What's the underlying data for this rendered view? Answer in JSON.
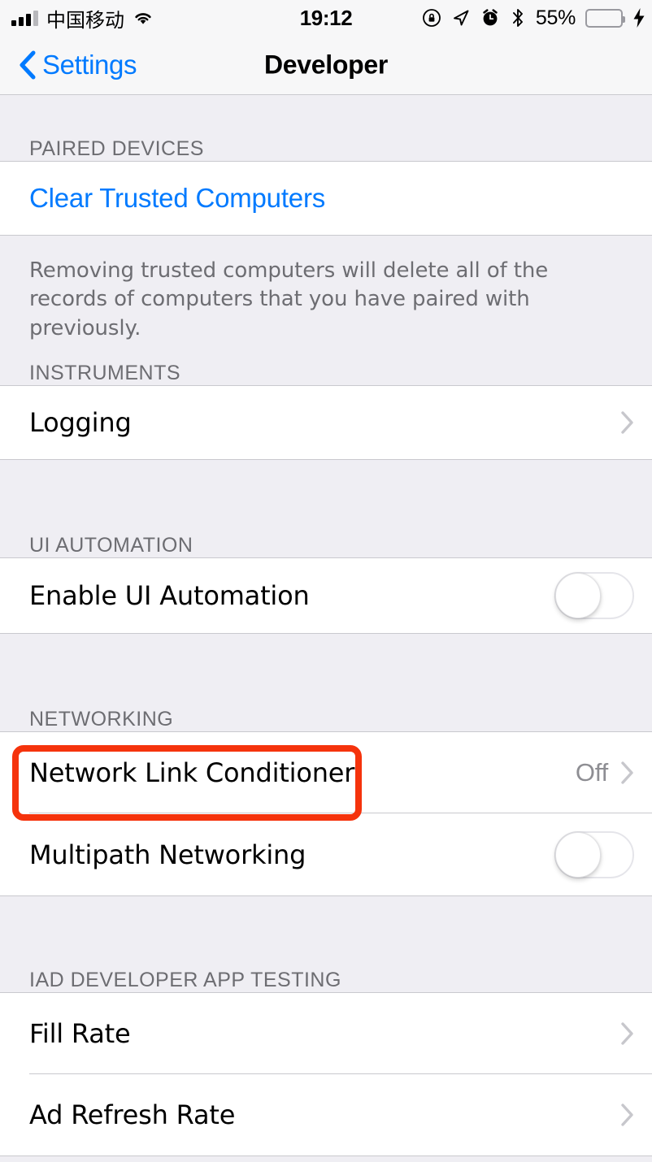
{
  "status_bar": {
    "carrier": "中国移动",
    "time": "19:12",
    "battery_percent": "55%",
    "signal_bars_filled": 3,
    "signal_bars_total": 4,
    "battery_fill_ratio": 0.55,
    "battery_color": "#4CD964",
    "icons": [
      "signal-bars-icon",
      "wifi-icon",
      "rotation-lock-icon",
      "location-arrow-icon",
      "alarm-clock-icon",
      "bluetooth-icon",
      "battery-icon",
      "charging-bolt-icon"
    ]
  },
  "nav_bar": {
    "back_label": "Settings",
    "title": "Developer",
    "accent_color": "#007AFF"
  },
  "sections": [
    {
      "header": "PAIRED DEVICES",
      "rows": [
        {
          "label": "Clear Trusted Computers",
          "type": "link"
        }
      ],
      "footer": "Removing trusted computers will delete all of the records of computers that you have paired with previously."
    },
    {
      "header": "INSTRUMENTS",
      "rows": [
        {
          "label": "Logging",
          "type": "disclosure"
        }
      ]
    },
    {
      "header": "UI AUTOMATION",
      "rows": [
        {
          "label": "Enable UI Automation",
          "type": "toggle",
          "value": "off"
        }
      ]
    },
    {
      "header": "NETWORKING",
      "rows": [
        {
          "label": "Network Link Conditioner",
          "type": "disclosure",
          "value": "Off",
          "highlighted": true
        },
        {
          "label": "Multipath Networking",
          "type": "toggle",
          "value": "off"
        }
      ]
    },
    {
      "header": "IAD DEVELOPER APP TESTING",
      "rows": [
        {
          "label": "Fill Rate",
          "type": "disclosure"
        },
        {
          "label": "Ad Refresh Rate",
          "type": "disclosure"
        }
      ]
    }
  ],
  "highlight": {
    "color": "#F5330C",
    "target": "Network Link Conditioner"
  }
}
